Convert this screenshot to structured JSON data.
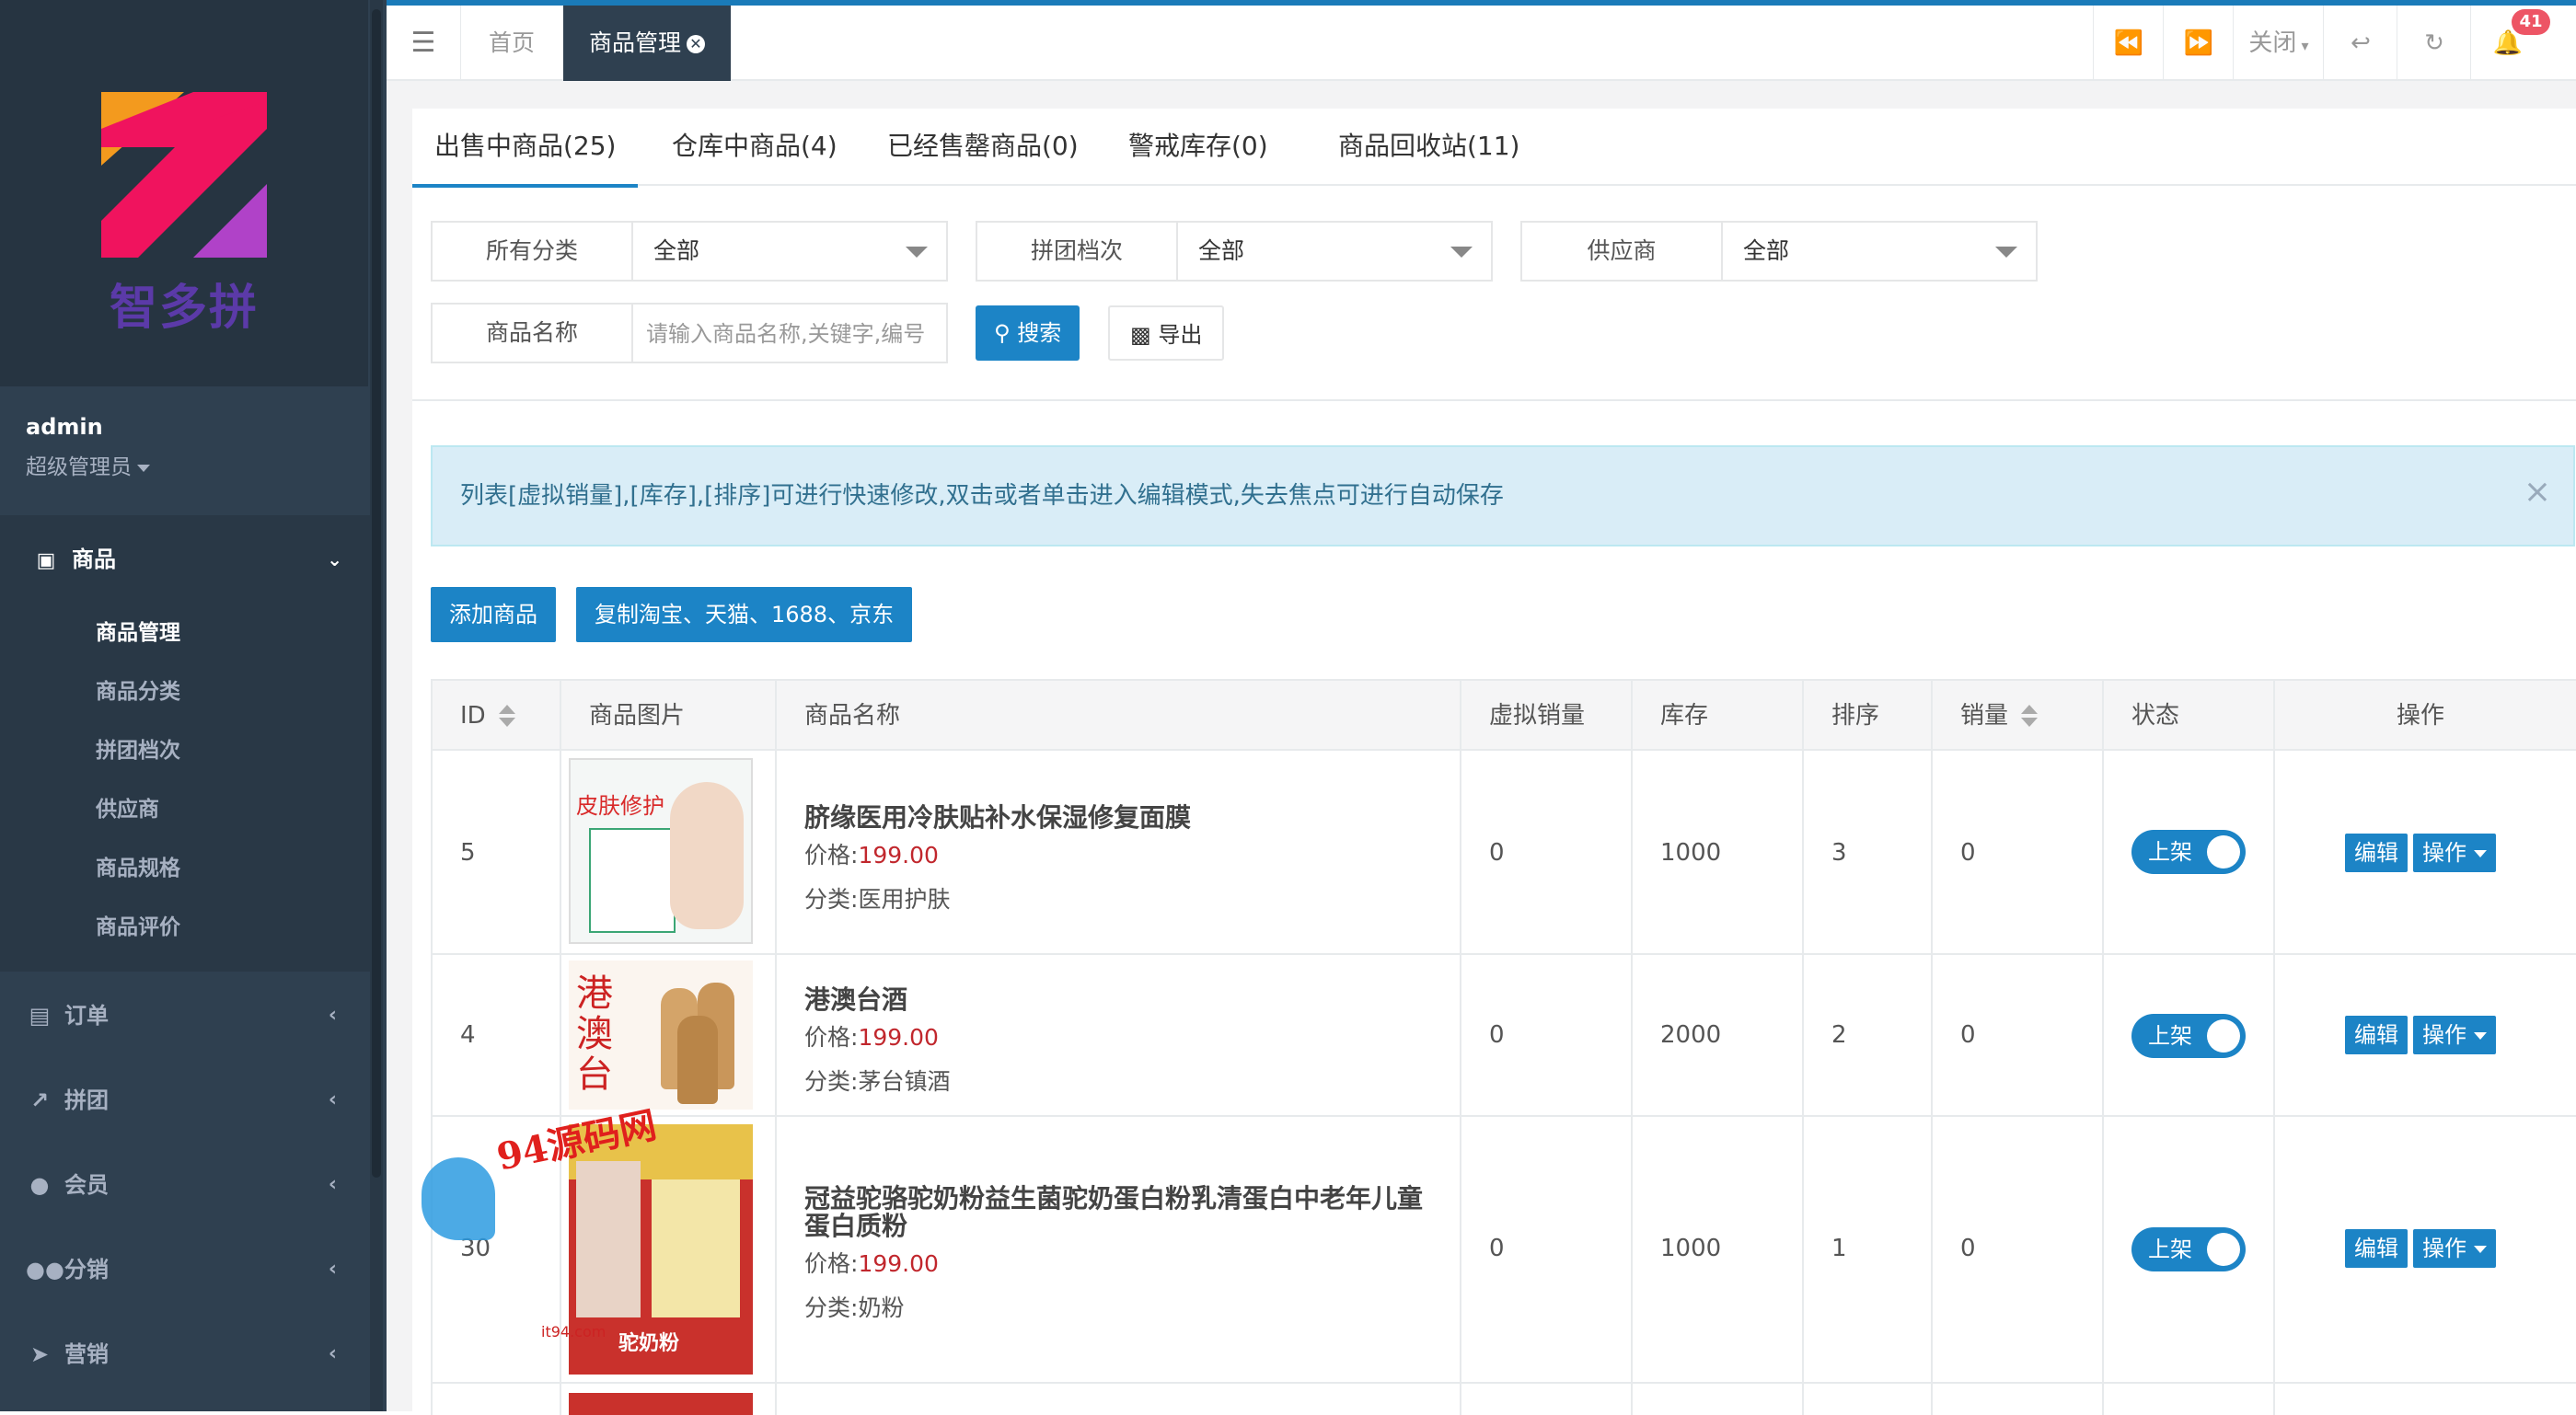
{
  "brand": {
    "name": "智多拼"
  },
  "user": {
    "name": "admin",
    "role": "超级管理员"
  },
  "sidebar": {
    "goods_group": {
      "label": "商品",
      "items": [
        "商品管理",
        "商品分类",
        "拼团档次",
        "供应商",
        "商品规格",
        "商品评价"
      ],
      "active_index": 0
    },
    "menus": [
      {
        "label": "订单",
        "icon": "document-icon"
      },
      {
        "label": "拼团",
        "icon": "chart-icon"
      },
      {
        "label": "会员",
        "icon": "user-icon"
      },
      {
        "label": "分销",
        "icon": "users-icon"
      },
      {
        "label": "营销",
        "icon": "send-icon"
      }
    ]
  },
  "topbar": {
    "tabs": [
      "首页",
      "商品管理"
    ],
    "close_label": "关闭",
    "notification_count": "41"
  },
  "subtabs": [
    "出售中商品(25)",
    "仓库中商品(4)",
    "已经售罄商品(0)",
    "警戒库存(0)",
    "商品回收站(11)"
  ],
  "filters": {
    "category": {
      "label": "所有分类",
      "value": "全部"
    },
    "tier": {
      "label": "拼团档次",
      "value": "全部"
    },
    "supplier": {
      "label": "供应商",
      "value": "全部"
    },
    "name": {
      "label": "商品名称",
      "placeholder": "请输入商品名称,关键字,编号"
    },
    "search_label": "搜索",
    "export_label": "导出"
  },
  "alert": {
    "text": "列表[虚拟销量],[库存],[排序]可进行快速修改,双击或者单击进入编辑模式,失去焦点可进行自动保存"
  },
  "actions": {
    "add_label": "添加商品",
    "copy_label": "复制淘宝、天猫、1688、京东"
  },
  "table": {
    "headers": [
      "ID",
      "商品图片",
      "商品名称",
      "虚拟销量",
      "库存",
      "排序",
      "销量",
      "状态",
      "操作"
    ],
    "price_prefix": "价格:",
    "category_prefix": "分类:",
    "status_label": "上架",
    "edit_label": "编辑",
    "op_label": "操作",
    "rows": [
      {
        "id": "5",
        "name": "脐缘医用冷肤贴补水保湿修复面膜",
        "price": "199.00",
        "category": "医用护肤",
        "virtual_sales": "0",
        "stock": "1000",
        "sort": "3",
        "sales": "0",
        "image_text": "皮肤修护"
      },
      {
        "id": "4",
        "name": "港澳台酒",
        "price": "199.00",
        "category": "茅台镇酒",
        "virtual_sales": "0",
        "stock": "2000",
        "sort": "2",
        "sales": "0",
        "image_text": "港澳台"
      },
      {
        "id": "30",
        "name": "冠益驼骆驼奶粉益生菌驼奶蛋白粉乳清蛋白中老年儿童蛋白质粉",
        "price": "199.00",
        "category": "奶粉",
        "virtual_sales": "0",
        "stock": "1000",
        "sort": "1",
        "sales": "0",
        "image_text": "驼奶粉"
      }
    ]
  },
  "watermark": {
    "text": "94源码网",
    "url": "it94.com"
  }
}
